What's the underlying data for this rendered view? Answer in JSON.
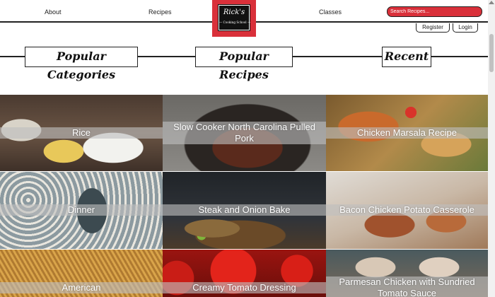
{
  "nav": {
    "about": "About",
    "recipes": "Recipes",
    "classes": "Classes"
  },
  "logo": {
    "title": "Rick's",
    "subtitle": "— Cooking School —"
  },
  "search": {
    "placeholder": "Search Recipes..."
  },
  "account": {
    "register": "Register",
    "login": "Login"
  },
  "sections": {
    "categories": "Popular Categories",
    "recipes": "Popular Recipes",
    "recent": "Recent"
  },
  "tiles": {
    "categories": [
      {
        "label": "Rice"
      },
      {
        "label": "Dinner"
      },
      {
        "label": "American"
      }
    ],
    "recipes": [
      {
        "label": "Slow Cooker North Carolina Pulled Pork"
      },
      {
        "label": "Steak and Onion Bake"
      },
      {
        "label": "Creamy Tomato Dressing"
      }
    ],
    "recent": [
      {
        "label": "Chicken Marsala Recipe"
      },
      {
        "label": "Bacon Chicken Potato Casserole"
      },
      {
        "label": "Parmesan Chicken with Sundried Tomato Sauce"
      }
    ]
  },
  "colors": {
    "accent": "#d9303a",
    "text": "#222222"
  }
}
